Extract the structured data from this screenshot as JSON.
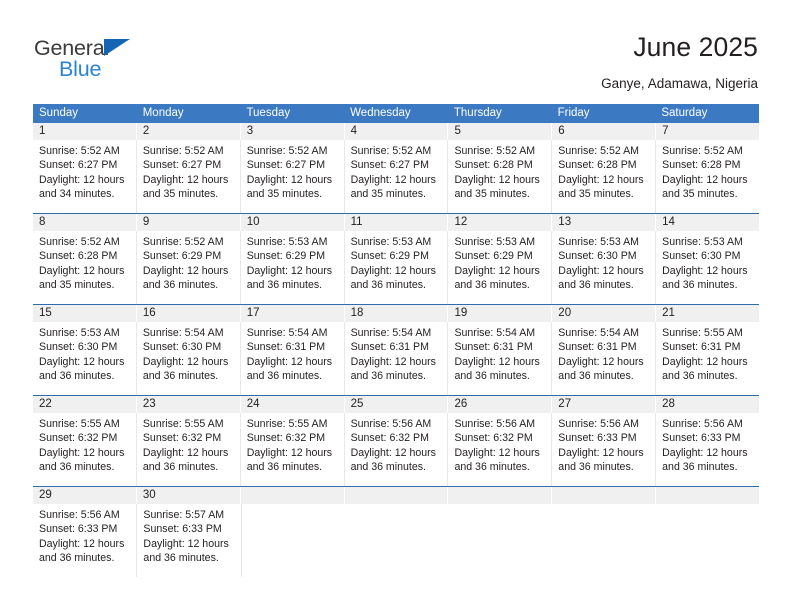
{
  "brand": {
    "word_one": "General",
    "word_two": "Blue",
    "triangle_color": "#1565b5",
    "blue_color": "#2b83d4",
    "gray_color": "#3b3b3b"
  },
  "header": {
    "title": "June 2025",
    "subtitle": "Ganye, Adamawa, Nigeria"
  },
  "theme": {
    "header_blue": "#3b79c2",
    "row_divider_blue": "#2f6cad",
    "daynum_band": "#f0f0f0",
    "text": "#231f20"
  },
  "calendar": {
    "weekdays": [
      "Sunday",
      "Monday",
      "Tuesday",
      "Wednesday",
      "Thursday",
      "Friday",
      "Saturday"
    ],
    "weeks": [
      [
        {
          "day": "1",
          "sunrise": "Sunrise: 5:52 AM",
          "sunset": "Sunset: 6:27 PM",
          "daylight_1": "Daylight: 12 hours",
          "daylight_2": "and 34 minutes."
        },
        {
          "day": "2",
          "sunrise": "Sunrise: 5:52 AM",
          "sunset": "Sunset: 6:27 PM",
          "daylight_1": "Daylight: 12 hours",
          "daylight_2": "and 35 minutes."
        },
        {
          "day": "3",
          "sunrise": "Sunrise: 5:52 AM",
          "sunset": "Sunset: 6:27 PM",
          "daylight_1": "Daylight: 12 hours",
          "daylight_2": "and 35 minutes."
        },
        {
          "day": "4",
          "sunrise": "Sunrise: 5:52 AM",
          "sunset": "Sunset: 6:27 PM",
          "daylight_1": "Daylight: 12 hours",
          "daylight_2": "and 35 minutes."
        },
        {
          "day": "5",
          "sunrise": "Sunrise: 5:52 AM",
          "sunset": "Sunset: 6:28 PM",
          "daylight_1": "Daylight: 12 hours",
          "daylight_2": "and 35 minutes."
        },
        {
          "day": "6",
          "sunrise": "Sunrise: 5:52 AM",
          "sunset": "Sunset: 6:28 PM",
          "daylight_1": "Daylight: 12 hours",
          "daylight_2": "and 35 minutes."
        },
        {
          "day": "7",
          "sunrise": "Sunrise: 5:52 AM",
          "sunset": "Sunset: 6:28 PM",
          "daylight_1": "Daylight: 12 hours",
          "daylight_2": "and 35 minutes."
        }
      ],
      [
        {
          "day": "8",
          "sunrise": "Sunrise: 5:52 AM",
          "sunset": "Sunset: 6:28 PM",
          "daylight_1": "Daylight: 12 hours",
          "daylight_2": "and 35 minutes."
        },
        {
          "day": "9",
          "sunrise": "Sunrise: 5:52 AM",
          "sunset": "Sunset: 6:29 PM",
          "daylight_1": "Daylight: 12 hours",
          "daylight_2": "and 36 minutes."
        },
        {
          "day": "10",
          "sunrise": "Sunrise: 5:53 AM",
          "sunset": "Sunset: 6:29 PM",
          "daylight_1": "Daylight: 12 hours",
          "daylight_2": "and 36 minutes."
        },
        {
          "day": "11",
          "sunrise": "Sunrise: 5:53 AM",
          "sunset": "Sunset: 6:29 PM",
          "daylight_1": "Daylight: 12 hours",
          "daylight_2": "and 36 minutes."
        },
        {
          "day": "12",
          "sunrise": "Sunrise: 5:53 AM",
          "sunset": "Sunset: 6:29 PM",
          "daylight_1": "Daylight: 12 hours",
          "daylight_2": "and 36 minutes."
        },
        {
          "day": "13",
          "sunrise": "Sunrise: 5:53 AM",
          "sunset": "Sunset: 6:30 PM",
          "daylight_1": "Daylight: 12 hours",
          "daylight_2": "and 36 minutes."
        },
        {
          "day": "14",
          "sunrise": "Sunrise: 5:53 AM",
          "sunset": "Sunset: 6:30 PM",
          "daylight_1": "Daylight: 12 hours",
          "daylight_2": "and 36 minutes."
        }
      ],
      [
        {
          "day": "15",
          "sunrise": "Sunrise: 5:53 AM",
          "sunset": "Sunset: 6:30 PM",
          "daylight_1": "Daylight: 12 hours",
          "daylight_2": "and 36 minutes."
        },
        {
          "day": "16",
          "sunrise": "Sunrise: 5:54 AM",
          "sunset": "Sunset: 6:30 PM",
          "daylight_1": "Daylight: 12 hours",
          "daylight_2": "and 36 minutes."
        },
        {
          "day": "17",
          "sunrise": "Sunrise: 5:54 AM",
          "sunset": "Sunset: 6:31 PM",
          "daylight_1": "Daylight: 12 hours",
          "daylight_2": "and 36 minutes."
        },
        {
          "day": "18",
          "sunrise": "Sunrise: 5:54 AM",
          "sunset": "Sunset: 6:31 PM",
          "daylight_1": "Daylight: 12 hours",
          "daylight_2": "and 36 minutes."
        },
        {
          "day": "19",
          "sunrise": "Sunrise: 5:54 AM",
          "sunset": "Sunset: 6:31 PM",
          "daylight_1": "Daylight: 12 hours",
          "daylight_2": "and 36 minutes."
        },
        {
          "day": "20",
          "sunrise": "Sunrise: 5:54 AM",
          "sunset": "Sunset: 6:31 PM",
          "daylight_1": "Daylight: 12 hours",
          "daylight_2": "and 36 minutes."
        },
        {
          "day": "21",
          "sunrise": "Sunrise: 5:55 AM",
          "sunset": "Sunset: 6:31 PM",
          "daylight_1": "Daylight: 12 hours",
          "daylight_2": "and 36 minutes."
        }
      ],
      [
        {
          "day": "22",
          "sunrise": "Sunrise: 5:55 AM",
          "sunset": "Sunset: 6:32 PM",
          "daylight_1": "Daylight: 12 hours",
          "daylight_2": "and 36 minutes."
        },
        {
          "day": "23",
          "sunrise": "Sunrise: 5:55 AM",
          "sunset": "Sunset: 6:32 PM",
          "daylight_1": "Daylight: 12 hours",
          "daylight_2": "and 36 minutes."
        },
        {
          "day": "24",
          "sunrise": "Sunrise: 5:55 AM",
          "sunset": "Sunset: 6:32 PM",
          "daylight_1": "Daylight: 12 hours",
          "daylight_2": "and 36 minutes."
        },
        {
          "day": "25",
          "sunrise": "Sunrise: 5:56 AM",
          "sunset": "Sunset: 6:32 PM",
          "daylight_1": "Daylight: 12 hours",
          "daylight_2": "and 36 minutes."
        },
        {
          "day": "26",
          "sunrise": "Sunrise: 5:56 AM",
          "sunset": "Sunset: 6:32 PM",
          "daylight_1": "Daylight: 12 hours",
          "daylight_2": "and 36 minutes."
        },
        {
          "day": "27",
          "sunrise": "Sunrise: 5:56 AM",
          "sunset": "Sunset: 6:33 PM",
          "daylight_1": "Daylight: 12 hours",
          "daylight_2": "and 36 minutes."
        },
        {
          "day": "28",
          "sunrise": "Sunrise: 5:56 AM",
          "sunset": "Sunset: 6:33 PM",
          "daylight_1": "Daylight: 12 hours",
          "daylight_2": "and 36 minutes."
        }
      ],
      [
        {
          "day": "29",
          "sunrise": "Sunrise: 5:56 AM",
          "sunset": "Sunset: 6:33 PM",
          "daylight_1": "Daylight: 12 hours",
          "daylight_2": "and 36 minutes."
        },
        {
          "day": "30",
          "sunrise": "Sunrise: 5:57 AM",
          "sunset": "Sunset: 6:33 PM",
          "daylight_1": "Daylight: 12 hours",
          "daylight_2": "and 36 minutes."
        },
        {
          "day": "",
          "sunrise": "",
          "sunset": "",
          "daylight_1": "",
          "daylight_2": ""
        },
        {
          "day": "",
          "sunrise": "",
          "sunset": "",
          "daylight_1": "",
          "daylight_2": ""
        },
        {
          "day": "",
          "sunrise": "",
          "sunset": "",
          "daylight_1": "",
          "daylight_2": ""
        },
        {
          "day": "",
          "sunrise": "",
          "sunset": "",
          "daylight_1": "",
          "daylight_2": ""
        },
        {
          "day": "",
          "sunrise": "",
          "sunset": "",
          "daylight_1": "",
          "daylight_2": ""
        }
      ]
    ]
  }
}
